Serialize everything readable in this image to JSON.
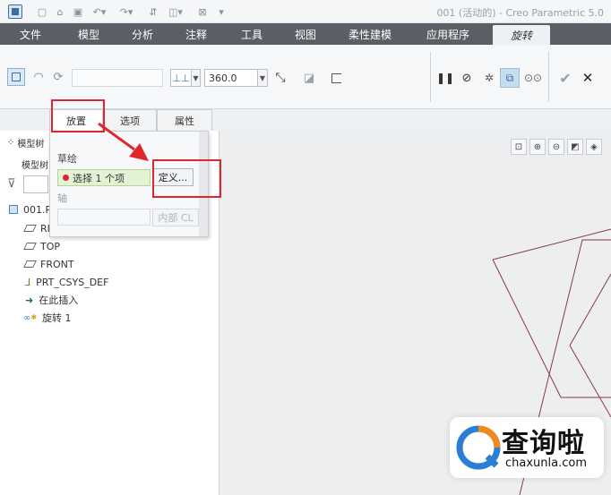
{
  "window": {
    "title": "001 (活动的) - Creo Parametric 5.0"
  },
  "ribbon_tabs": [
    "文件",
    "模型",
    "分析",
    "注释",
    "工具",
    "视图",
    "柔性建模",
    "应用程序",
    "旋转"
  ],
  "active_ribbon_tab": "旋转",
  "ribbon": {
    "angle_value": "360.0"
  },
  "dashboard_tabs": [
    "放置",
    "选项",
    "属性"
  ],
  "placement_panel": {
    "sketch_label": "草绘",
    "sketch_collector": "选择 1 个项",
    "define_button": "定义...",
    "axis_label": "轴",
    "internal_cl_button": "内部 CL"
  },
  "model_tree": {
    "header_label": "模型树",
    "sub_label": "模型树",
    "root": "001.PRT",
    "items": [
      "RIGHT",
      "TOP",
      "FRONT",
      "PRT_CSYS_DEF",
      "在此插入",
      "旋转 1"
    ]
  },
  "watermark": {
    "brand": "查询啦",
    "url": "chaxunla.com"
  },
  "colors": {
    "annotation_red": "#e0262d",
    "tab_bar_bg": "#5a5f66",
    "sketch_line": "#8a3a46"
  }
}
